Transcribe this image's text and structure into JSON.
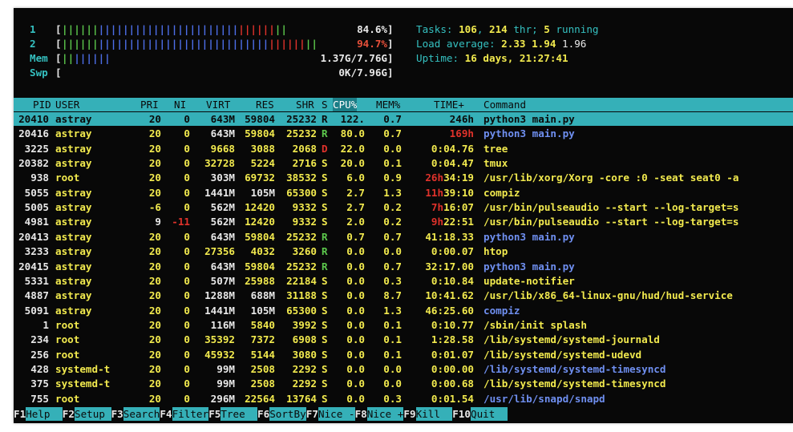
{
  "meters": {
    "cpu1": {
      "label": "1",
      "percent": "84.6%",
      "fill": 0.846
    },
    "cpu2": {
      "label": "2",
      "percent": "94.7%",
      "fill": 0.947
    },
    "mem": {
      "label": "Mem",
      "value": "1.37G/7.76G",
      "fill": 0.18
    },
    "swp": {
      "label": "Swp",
      "value": "0K/7.96G",
      "fill": 0.0
    }
  },
  "summary": {
    "tasks_label": "Tasks: ",
    "tasks": "106",
    "sep": ", ",
    "thr": "214",
    "thr_label": " thr; ",
    "running": "5",
    "running_label": " running",
    "load_label": "Load average: ",
    "load1": "2.33",
    "load5": "1.94",
    "load15": "1.96",
    "uptime_label": "Uptime: ",
    "uptime": "16 days, 21:27:41"
  },
  "columns": {
    "pid": "PID",
    "user": "USER",
    "pri": "PRI",
    "ni": "NI",
    "virt": "VIRT",
    "res": "RES",
    "shr": "SHR",
    "s": "S",
    "cpu": "CPU%",
    "mem": "MEM%",
    "time": "TIME+",
    "command": "Command"
  },
  "processes": [
    {
      "pid": "20410",
      "user": "astray",
      "pri": "20",
      "ni": "0",
      "virt": "643M",
      "res": "59804",
      "shr": "25232",
      "s": "R",
      "cpu": "122.",
      "mem": "0.7",
      "time": "246h",
      "command": "python3 main.py",
      "selected": true
    },
    {
      "pid": "20416",
      "user": "astray",
      "pri": "20",
      "ni": "0",
      "virt": "643M",
      "res": "59804",
      "shr": "25232",
      "s": "R",
      "cpu": "80.0",
      "mem": "0.7",
      "time": "169h",
      "command": "python3 main.py",
      "thread": true,
      "hot": true
    },
    {
      "pid": "3225",
      "user": "astray",
      "pri": "20",
      "ni": "0",
      "virt": "9668",
      "res": "3088",
      "shr": "2068",
      "s": "D",
      "cpu": "22.0",
      "mem": "0.0",
      "time": "0:04.76",
      "command": "tree",
      "dstate": true
    },
    {
      "pid": "20382",
      "user": "astray",
      "pri": "20",
      "ni": "0",
      "virt": "32728",
      "res": "5224",
      "shr": "2716",
      "s": "S",
      "cpu": "20.0",
      "mem": "0.1",
      "time": "0:04.47",
      "command": "tmux"
    },
    {
      "pid": "938",
      "user": "root",
      "pri": "20",
      "ni": "0",
      "virt": "303M",
      "res": "69732",
      "shr": "38532",
      "s": "S",
      "cpu": "6.0",
      "mem": "0.9",
      "time": "26h34:19",
      "command": "/usr/lib/xorg/Xorg -core :0 -seat seat0 -a",
      "hours": "26h",
      "rest": "34:19"
    },
    {
      "pid": "5055",
      "user": "astray",
      "pri": "20",
      "ni": "0",
      "virt": "1441M",
      "res": "105M",
      "shr": "65300",
      "s": "S",
      "cpu": "2.7",
      "mem": "1.3",
      "time": "11h39:10",
      "command": "compiz",
      "hours": "11h",
      "rest": "39:10"
    },
    {
      "pid": "5005",
      "user": "astray",
      "pri": "-6",
      "ni": "0",
      "virt": "562M",
      "res": "12420",
      "shr": "9332",
      "s": "S",
      "cpu": "2.7",
      "mem": "0.2",
      "time": "7h16:07",
      "command": "/usr/bin/pulseaudio --start --log-target=s",
      "hours": "7h",
      "rest": "16:07"
    },
    {
      "pid": "4981",
      "user": "astray",
      "pri": "9",
      "ni": "-11",
      "virt": "562M",
      "res": "12420",
      "shr": "9332",
      "s": "S",
      "cpu": "2.0",
      "mem": "0.2",
      "time": "9h22:51",
      "command": "/usr/bin/pulseaudio --start --log-target=s",
      "hours": "9h",
      "rest": "22:51",
      "neg": true
    },
    {
      "pid": "20413",
      "user": "astray",
      "pri": "20",
      "ni": "0",
      "virt": "643M",
      "res": "59804",
      "shr": "25232",
      "s": "R",
      "cpu": "0.7",
      "mem": "0.7",
      "time": "41:18.33",
      "command": "python3 main.py",
      "thread": true
    },
    {
      "pid": "3233",
      "user": "astray",
      "pri": "20",
      "ni": "0",
      "virt": "27356",
      "res": "4032",
      "shr": "3260",
      "s": "R",
      "cpu": "0.0",
      "mem": "0.0",
      "time": "0:00.07",
      "command": "htop"
    },
    {
      "pid": "20415",
      "user": "astray",
      "pri": "20",
      "ni": "0",
      "virt": "643M",
      "res": "59804",
      "shr": "25232",
      "s": "R",
      "cpu": "0.0",
      "mem": "0.7",
      "time": "32:17.00",
      "command": "python3 main.py",
      "thread": true
    },
    {
      "pid": "5331",
      "user": "astray",
      "pri": "20",
      "ni": "0",
      "virt": "507M",
      "res": "25988",
      "shr": "22184",
      "s": "S",
      "cpu": "0.0",
      "mem": "0.3",
      "time": "0:10.84",
      "command": "update-notifier"
    },
    {
      "pid": "4887",
      "user": "astray",
      "pri": "20",
      "ni": "0",
      "virt": "1288M",
      "res": "688M",
      "shr": "31188",
      "s": "S",
      "cpu": "0.0",
      "mem": "8.7",
      "time": "10:41.62",
      "command": "/usr/lib/x86_64-linux-gnu/hud/hud-service"
    },
    {
      "pid": "5091",
      "user": "astray",
      "pri": "20",
      "ni": "0",
      "virt": "1441M",
      "res": "105M",
      "shr": "65300",
      "s": "S",
      "cpu": "0.0",
      "mem": "1.3",
      "time": "46:25.60",
      "command": "compiz",
      "thread": true
    },
    {
      "pid": "1",
      "user": "root",
      "pri": "20",
      "ni": "0",
      "virt": "116M",
      "res": "5840",
      "shr": "3992",
      "s": "S",
      "cpu": "0.0",
      "mem": "0.1",
      "time": "0:10.77",
      "command": "/sbin/init splash"
    },
    {
      "pid": "234",
      "user": "root",
      "pri": "20",
      "ni": "0",
      "virt": "35392",
      "res": "7372",
      "shr": "6908",
      "s": "S",
      "cpu": "0.0",
      "mem": "0.1",
      "time": "1:28.58",
      "command": "/lib/systemd/systemd-journald"
    },
    {
      "pid": "256",
      "user": "root",
      "pri": "20",
      "ni": "0",
      "virt": "45932",
      "res": "5144",
      "shr": "3080",
      "s": "S",
      "cpu": "0.0",
      "mem": "0.1",
      "time": "0:01.07",
      "command": "/lib/systemd/systemd-udevd"
    },
    {
      "pid": "428",
      "user": "systemd-t",
      "pri": "20",
      "ni": "0",
      "virt": "99M",
      "res": "2508",
      "shr": "2292",
      "s": "S",
      "cpu": "0.0",
      "mem": "0.0",
      "time": "0:00.00",
      "command": "/lib/systemd/systemd-timesyncd",
      "thread": true
    },
    {
      "pid": "375",
      "user": "systemd-t",
      "pri": "20",
      "ni": "0",
      "virt": "99M",
      "res": "2508",
      "shr": "2292",
      "s": "S",
      "cpu": "0.0",
      "mem": "0.0",
      "time": "0:00.68",
      "command": "/lib/systemd/systemd-timesyncd"
    },
    {
      "pid": "755",
      "user": "root",
      "pri": "20",
      "ni": "0",
      "virt": "296M",
      "res": "22564",
      "shr": "13764",
      "s": "S",
      "cpu": "0.0",
      "mem": "0.3",
      "time": "0:01.54",
      "command": "/usr/lib/snapd/snapd",
      "thread": true
    }
  ],
  "function_keys": [
    {
      "key": "F1",
      "label": "Help  "
    },
    {
      "key": "F2",
      "label": "Setup "
    },
    {
      "key": "F3",
      "label": "Search"
    },
    {
      "key": "F4",
      "label": "Filter"
    },
    {
      "key": "F5",
      "label": "Tree  "
    },
    {
      "key": "F6",
      "label": "SortBy"
    },
    {
      "key": "F7",
      "label": "Nice -"
    },
    {
      "key": "F8",
      "label": "Nice +"
    },
    {
      "key": "F9",
      "label": "Kill  "
    },
    {
      "key": "F10",
      "label": "Quit  "
    }
  ],
  "colors": {
    "header_bg": "#35b0b8",
    "terminal_bg": "#080808",
    "text_yellow": "#f2ea4e",
    "bar_green": "#5cc84c",
    "bar_red": "#e0322b",
    "bar_blue": "#4d6ee8"
  }
}
